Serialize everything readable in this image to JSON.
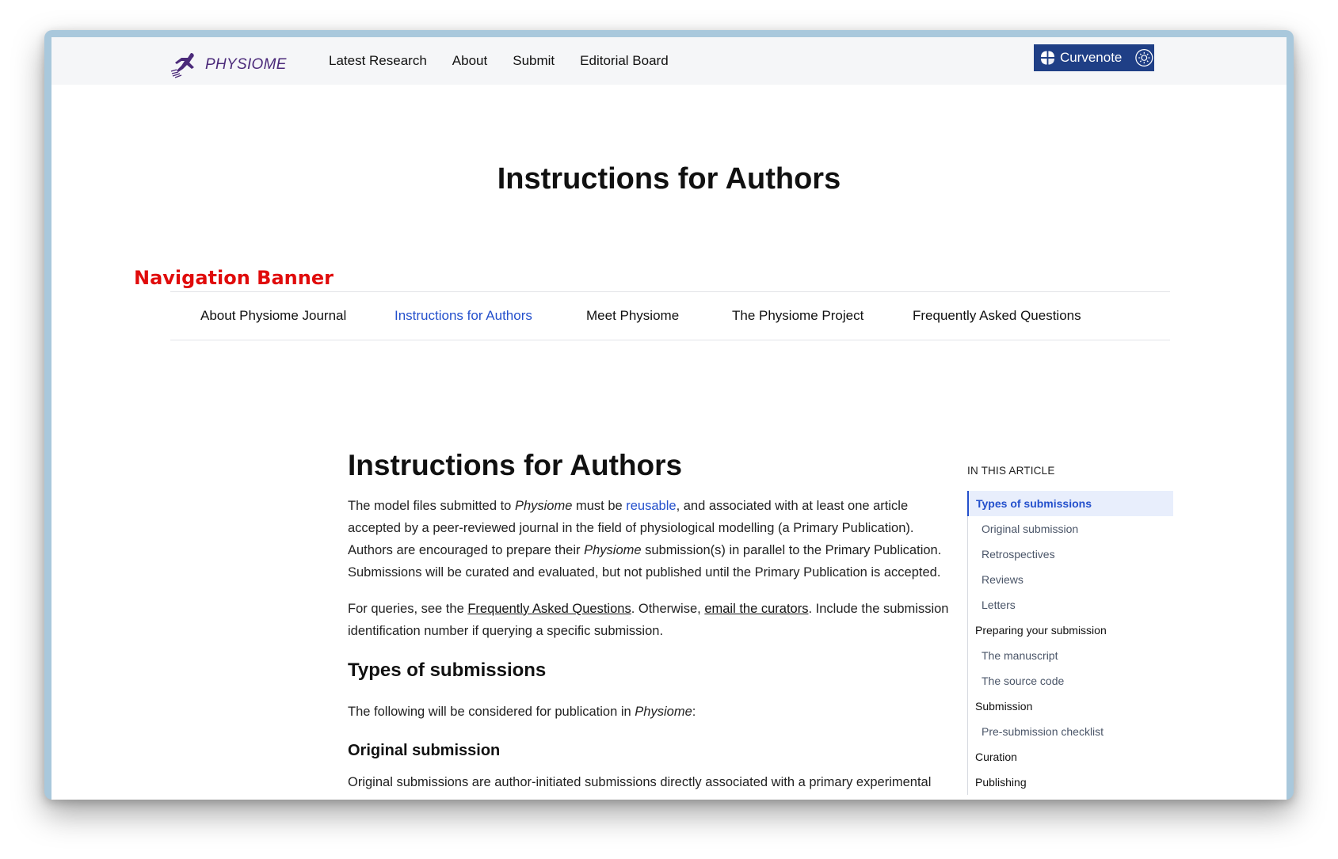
{
  "topnav": {
    "logo_text": "PHYSIOME",
    "links": [
      "Latest Research",
      "About",
      "Submit",
      "Editorial Board"
    ],
    "curvenote_label": "Curvenote"
  },
  "hero": {
    "title": "Instructions for Authors"
  },
  "annotation": {
    "label": "Navigation Banner"
  },
  "subnav": {
    "items": [
      {
        "label": "About Physiome Journal",
        "active": false
      },
      {
        "label": "Instructions for Authors",
        "active": true
      },
      {
        "label": "Meet Physiome",
        "active": false
      },
      {
        "label": "The Physiome Project",
        "active": false
      },
      {
        "label": "Frequently Asked Questions",
        "active": false
      }
    ]
  },
  "article": {
    "title": "Instructions for Authors",
    "intro": {
      "t1": "The model files submitted to ",
      "em1": "Physiome",
      "t2": " must be ",
      "link1": "reusable",
      "t3": ", and associated with at least one article accepted by a peer-reviewed journal in the field of physiological modelling (a Primary Publication). Authors are encouraged to prepare their ",
      "em2": "Physiome",
      "t4": " submission(s) in parallel to the Primary Publication. Submissions will be curated and evaluated, but not published until the Primary Publication is accepted."
    },
    "queries": {
      "t1": "For queries, see the ",
      "link1": "Frequently Asked Questions",
      "t2": ". Otherwise, ",
      "link2": "email the curators",
      "t3": ". Include the submission identification number if querying a specific submission."
    },
    "section_title": "Types of submissions",
    "section_text": {
      "t1": "The following will be considered for publication in ",
      "em1": "Physiome",
      "t2": ":"
    },
    "subsection_title": "Original submission",
    "subsection_text": "Original submissions are author-initiated submissions directly associated with a primary experimental"
  },
  "toc": {
    "heading": "IN THIS ARTICLE",
    "items": [
      {
        "label": "Types of submissions",
        "level": 1,
        "active": true
      },
      {
        "label": "Original submission",
        "level": 2
      },
      {
        "label": "Retrospectives",
        "level": 2
      },
      {
        "label": "Reviews",
        "level": 2
      },
      {
        "label": "Letters",
        "level": 2
      },
      {
        "label": "Preparing your submission",
        "level": 1
      },
      {
        "label": "The manuscript",
        "level": 2
      },
      {
        "label": "The source code",
        "level": 2
      },
      {
        "label": "Submission",
        "level": 1
      },
      {
        "label": "Pre-submission checklist",
        "level": 2
      },
      {
        "label": "Curation",
        "level": 1
      },
      {
        "label": "Publishing",
        "level": 1
      }
    ]
  },
  "colors": {
    "accent": "#2450cc",
    "annotation": "#e00b0b",
    "curvenote_bg": "#1f3f86",
    "frame": "#a9c8dc"
  }
}
